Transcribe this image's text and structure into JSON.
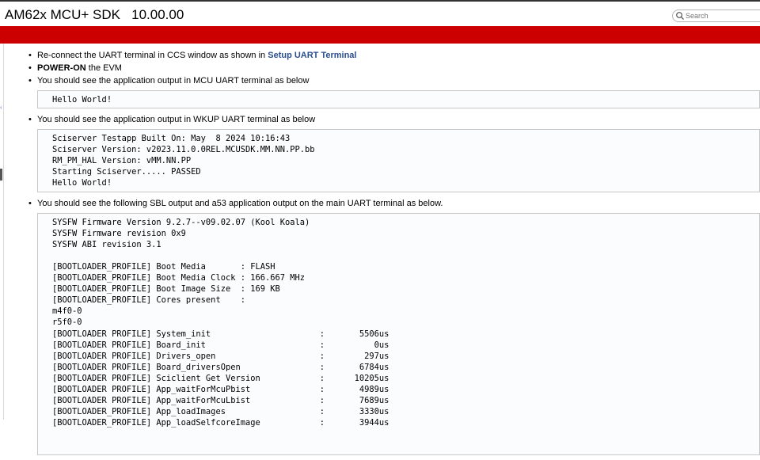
{
  "header": {
    "title": "AM62x MCU+ SDK   10.00.00",
    "search_placeholder": "Search"
  },
  "steps": [
    {
      "before": "Re-connect the UART terminal in CCS window as shown in ",
      "link": "Setup UART Terminal"
    },
    {
      "bold": "POWER-ON",
      "text": " the EVM"
    },
    {
      "text": "You should see the application output in MCU UART terminal as below"
    },
    {
      "text": "You should see the application output in WKUP UART terminal as below"
    },
    {
      "text": "You should see the following SBL output and a53 application output on the main UART terminal as below."
    }
  ],
  "mcu_output": [
    "Hello World!"
  ],
  "wkup_output": [
    "Sciserver Testapp Built On: May  8 2024 10:16:43",
    "Sciserver Version: v2023.11.0.0REL.MCUSDK.MM.NN.PP.bb",
    "RM_PM_HAL Version: vMM.NN.PP",
    "Starting Sciserver..... PASSED",
    "Hello World!"
  ],
  "main_output": [
    "SYSFW Firmware Version 9.2.7--v09.02.07 (Kool Koala)",
    "SYSFW Firmware revision 0x9",
    "SYSFW ABI revision 3.1",
    "",
    "[BOOTLOADER_PROFILE] Boot Media       : FLASH",
    "[BOOTLOADER_PROFILE] Boot Media Clock : 166.667 MHz",
    "[BOOTLOADER_PROFILE] Boot Image Size  : 169 KB",
    "[BOOTLOADER_PROFILE] Cores present    :",
    "m4f0-0",
    "r5f0-0",
    "[BOOTLOADER PROFILE] System_init                      :       5506us",
    "[BOOTLOADER PROFILE] Board_init                       :          0us",
    "[BOOTLOADER PROFILE] Drivers_open                     :        297us",
    "[BOOTLOADER PROFILE] Board_driversOpen                :       6784us",
    "[BOOTLOADER PROFILE] Sciclient Get Version            :      10205us",
    "[BOOTLOADER PROFILE] App_waitForMcuPbist              :       4989us",
    "[BOOTLOADER PROFILE] App_waitForMcuLbist              :       7689us",
    "[BOOTLOADER_PROFILE] App_loadImages                   :       3330us",
    "[BOOTLOADER_PROFILE] App_loadSelfcoreImage            :       3944us"
  ]
}
